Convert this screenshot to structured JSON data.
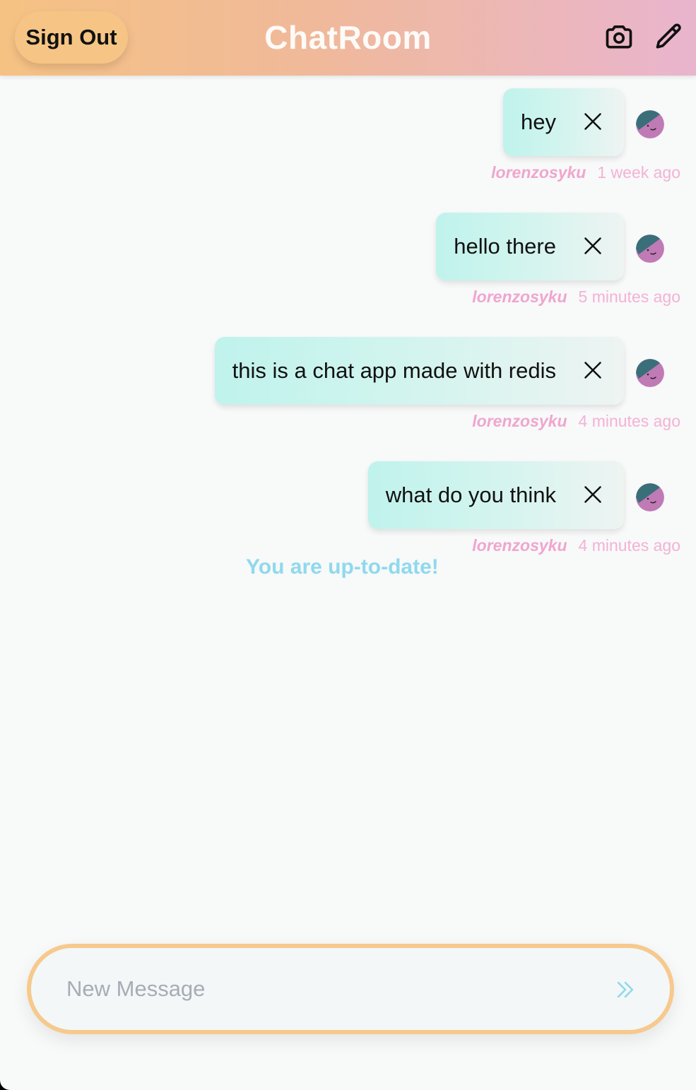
{
  "header": {
    "sign_out_label": "Sign Out",
    "title": "ChatRoom",
    "icons": [
      "camera-icon",
      "pencil-icon"
    ]
  },
  "messages": [
    {
      "text": "hey",
      "user": "lorenzosyku",
      "time": "1 week ago"
    },
    {
      "text": "hello there",
      "user": "lorenzosyku",
      "time": "5 minutes ago"
    },
    {
      "text": "this is a chat app made with redis",
      "user": "lorenzosyku",
      "time": "4 minutes ago"
    },
    {
      "text": "what do you think",
      "user": "lorenzosyku",
      "time": "4 minutes ago"
    }
  ],
  "status_text": "You are up-to-date!",
  "composer": {
    "placeholder": "New Message",
    "send_icon": "double-chevron-right-icon"
  },
  "colors": {
    "header_gradient_start": "#f6c283",
    "header_gradient_end": "#e9b5ce",
    "bubble": "#bff3ec",
    "username": "#efa6cf",
    "status": "#8fd9ed",
    "composer_border": "#f6c98d"
  }
}
